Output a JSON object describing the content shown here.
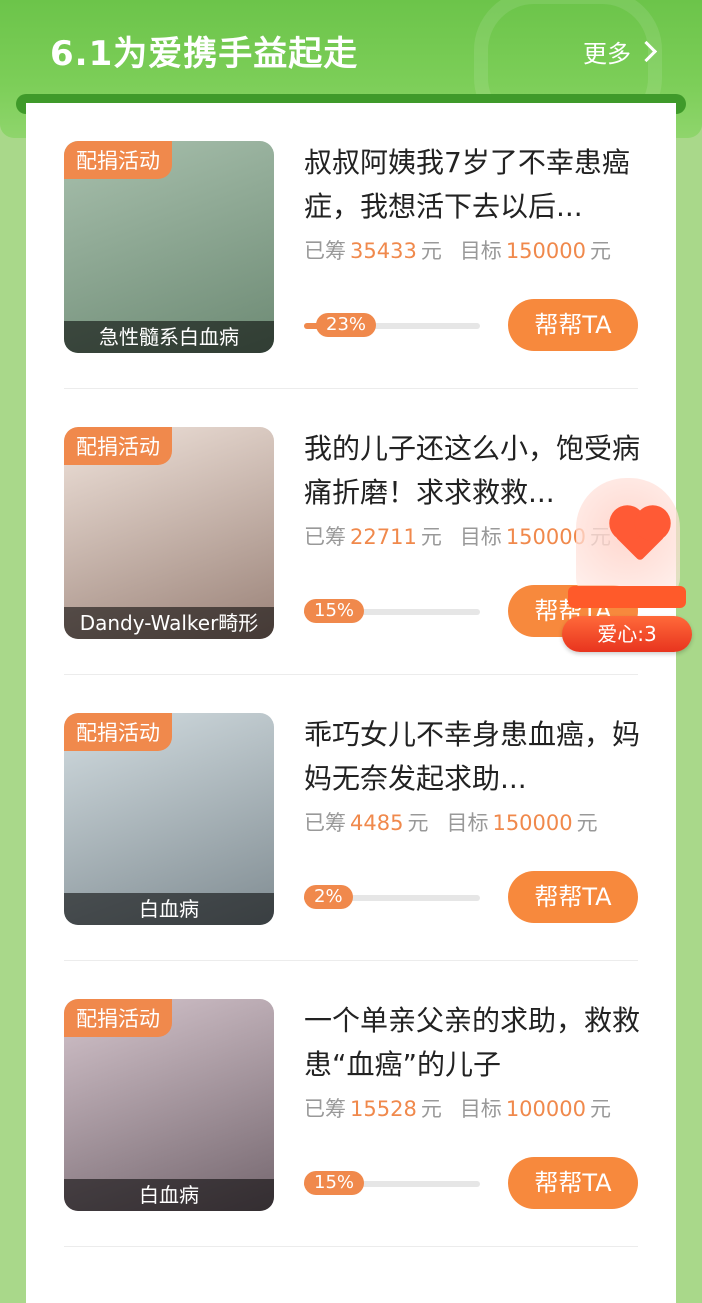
{
  "header": {
    "title": "6.1为爱携手益起走",
    "more_label": "更多"
  },
  "labels": {
    "raised": "已筹",
    "goal": "目标",
    "unit": "元",
    "help_button": "帮帮TA"
  },
  "projects": [
    {
      "tag": "配捐活动",
      "caption": "急性髓系白血病",
      "title": "叔叔阿姨我7岁了不幸患癌症，我想活下去以后...",
      "raised": "35433",
      "goal": "150000",
      "percent_label": "23%",
      "progress": 0.23,
      "image_colors": [
        "#9fb6a4",
        "#5f7a66"
      ]
    },
    {
      "tag": "配捐活动",
      "caption": "Dandy-Walker畸形",
      "title": "我的儿子还这么小，饱受病痛折磨！求求救救...",
      "raised": "22711",
      "goal": "150000",
      "percent_label": "15%",
      "progress": 0.15,
      "image_colors": [
        "#e4d2c8",
        "#8a7268"
      ]
    },
    {
      "tag": "配捐活动",
      "caption": "白血病",
      "title": "乖巧女儿不幸身患血癌，妈妈无奈发起求助...",
      "raised": "4485",
      "goal": "150000",
      "percent_label": "2%",
      "progress": 0.02,
      "image_colors": [
        "#c9d4d8",
        "#7e8a90"
      ]
    },
    {
      "tag": "配捐活动",
      "caption": "白血病",
      "title": "一个单亲父亲的求助，救救患“血癌”的儿子",
      "raised": "15528",
      "goal": "100000",
      "percent_label": "15%",
      "progress": 0.15,
      "image_colors": [
        "#c8b8c0",
        "#6e6068"
      ]
    }
  ],
  "love_widget": {
    "label": "爱心:3"
  }
}
